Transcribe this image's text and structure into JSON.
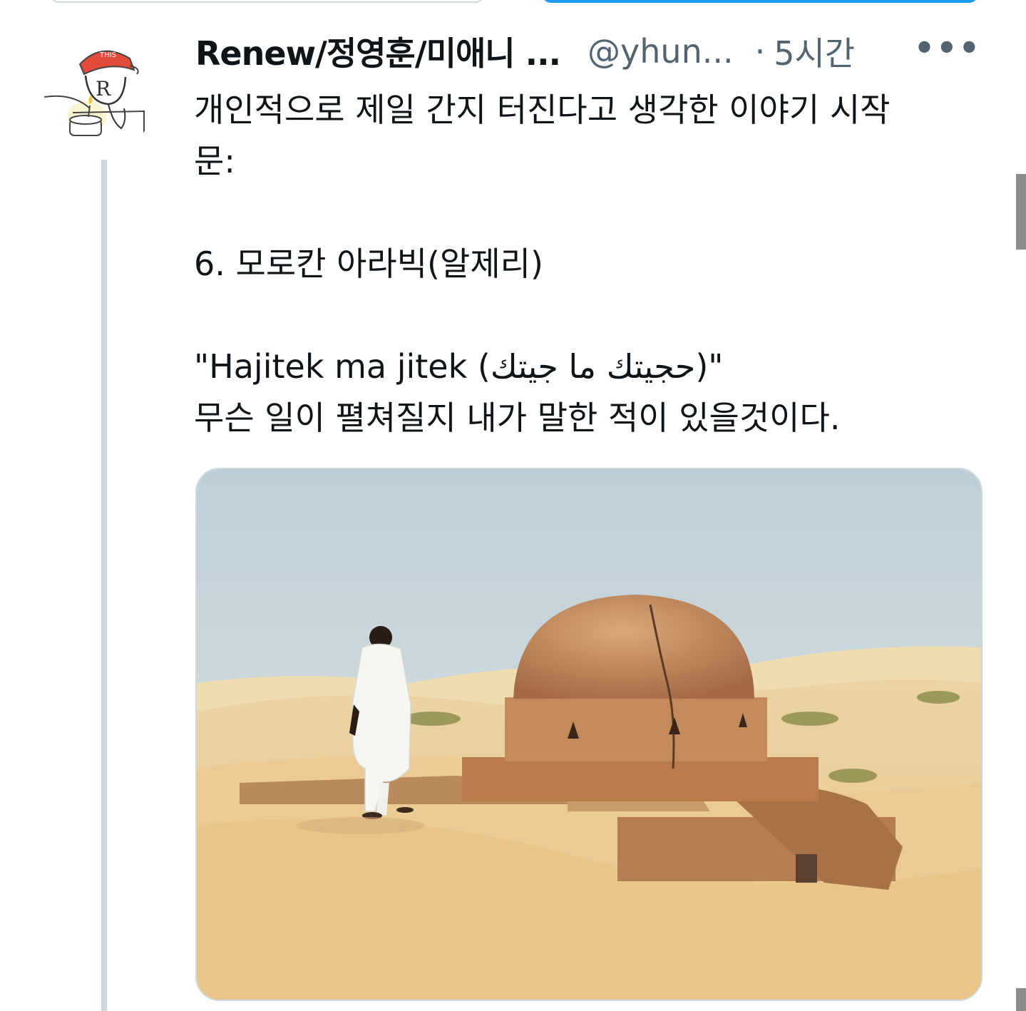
{
  "tweet": {
    "display_name": "Renew/정영훈/미애니 ...",
    "handle": "@yhun...",
    "separator": "·",
    "time": "5시간",
    "more_icon": "more-horizontal-icon",
    "text_line1": "개인적으로 제일 간지 터진다고 생각한 이야기 시작",
    "text_line2": "문:",
    "text_line3": "6. 모로칸 아라빅(알제리)",
    "text_line4": "\"Hajitek ma jitek (حجيتك ما جيتك)\"",
    "text_line5": "무슨 일이 펼쳐질지 내가 말한 적이 있을것이다."
  },
  "avatar": {
    "icon": "cartoon-avatar-icon",
    "cap_text": "THIS"
  },
  "colors": {
    "accent": "#1d9bf0",
    "secondary_text": "#536471",
    "border": "#cfd9de"
  }
}
